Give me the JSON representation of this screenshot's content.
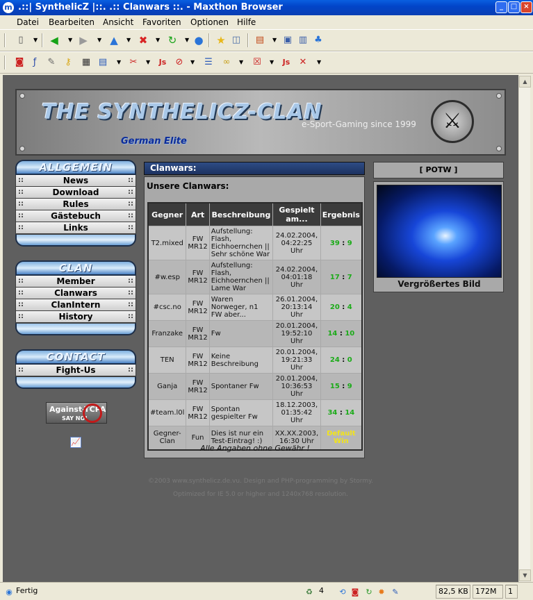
{
  "window": {
    "title": ".::| SynthelicZ |::. .:: Clanwars ::. - Maxthon Browser",
    "app_icon": "m"
  },
  "menu": [
    {
      "label": "Datei"
    },
    {
      "label": "Bearbeiten"
    },
    {
      "label": "Ansicht"
    },
    {
      "label": "Favoriten"
    },
    {
      "label": "Optionen"
    },
    {
      "label": "Hilfe"
    }
  ],
  "page": {
    "banner": {
      "logo": "THE SYNTHELICZ-CLAN",
      "sublogo": "German Elite",
      "tagline": "e-Sport-Gaming since 1999"
    },
    "nav": {
      "allgemein": {
        "title": "ALLGEMEIN",
        "items": [
          "News",
          "Download",
          "Rules",
          "Gästebuch",
          "Links"
        ]
      },
      "clan": {
        "title": "CLAN",
        "items": [
          "Member",
          "Clanwars",
          "ClanIntern",
          "History"
        ]
      },
      "contact": {
        "title": "CONTACT",
        "items": [
          "Fight-Us"
        ]
      },
      "dots": "::"
    },
    "against_banner": {
      "line1": "Against-TCPA",
      "line2": "SAY NO!"
    },
    "clanwars": {
      "header": "Clanwars:",
      "subtitle": "Unsere Clanwars:",
      "columns": [
        "Gegner",
        "Art",
        "Beschreibung",
        "Gespielt am...",
        "Ergebnis"
      ],
      "rows": [
        {
          "gegner": "T2.mixed",
          "art": "FW MR12",
          "desc": "Aufstellung: Flash, Eichhoernchen || Sehr schöne War",
          "date": "24.02.2004, 04:22:25 Uhr",
          "s1": "39",
          "s2": "9"
        },
        {
          "gegner": "#w.esp",
          "art": "FW MR12",
          "desc": "Aufstellung: Flash, Eichhoernchen || Lame War",
          "date": "24.02.2004, 04:01:18 Uhr",
          "s1": "17",
          "s2": "7"
        },
        {
          "gegner": "#csc.no",
          "art": "FW MR12",
          "desc": "Waren Norweger, n1 FW aber...",
          "date": "26.01.2004, 20:13:14 Uhr",
          "s1": "20",
          "s2": "4"
        },
        {
          "gegner": "Franzake",
          "art": "FW MR12",
          "desc": "Fw",
          "date": "20.01.2004, 19:52:10 Uhr",
          "s1": "14",
          "s2": "10"
        },
        {
          "gegner": "TEN",
          "art": "FW MR12",
          "desc": "Keine Beschreibung",
          "date": "20.01.2004, 19:21:33 Uhr",
          "s1": "24",
          "s2": "0"
        },
        {
          "gegner": "Ganja",
          "art": "FW MR12",
          "desc": "Spontaner Fw",
          "date": "20.01.2004, 10:36:53 Uhr",
          "s1": "15",
          "s2": "9"
        },
        {
          "gegner": "#team.l0l",
          "art": "FW MR12",
          "desc": "Spontan gespielter Fw",
          "date": "18.12.2003, 01:35:42 Uhr",
          "s1": "34",
          "s2": "14"
        },
        {
          "gegner": "Gegner-Clan",
          "art": "Fun",
          "desc": "Dies ist nur ein Test-Eintrag! :)",
          "date": "XX.XX.2003, 16:30 Uhr",
          "result_text": "Default Win"
        }
      ],
      "footnote": "Alle Angaben ohne Gewähr !"
    },
    "potw": {
      "header": "[ POTW ]",
      "caption": "Vergrößertes Bild"
    },
    "footer": {
      "line1": "©2003 www.synthelicz.de.vu. Design and PHP-programming by Stormy.",
      "line2": "Optimized for IE 5.0 or higher and 1240x768 resolution."
    }
  },
  "status": {
    "text": "Fertig",
    "tabs": "4",
    "size": "82,5 KB",
    "memory": "172M",
    "count": "1"
  },
  "colors": {
    "win_score": "#1bab18",
    "default_win": "#f2e41a",
    "page_bg": "#5f5f5f"
  }
}
